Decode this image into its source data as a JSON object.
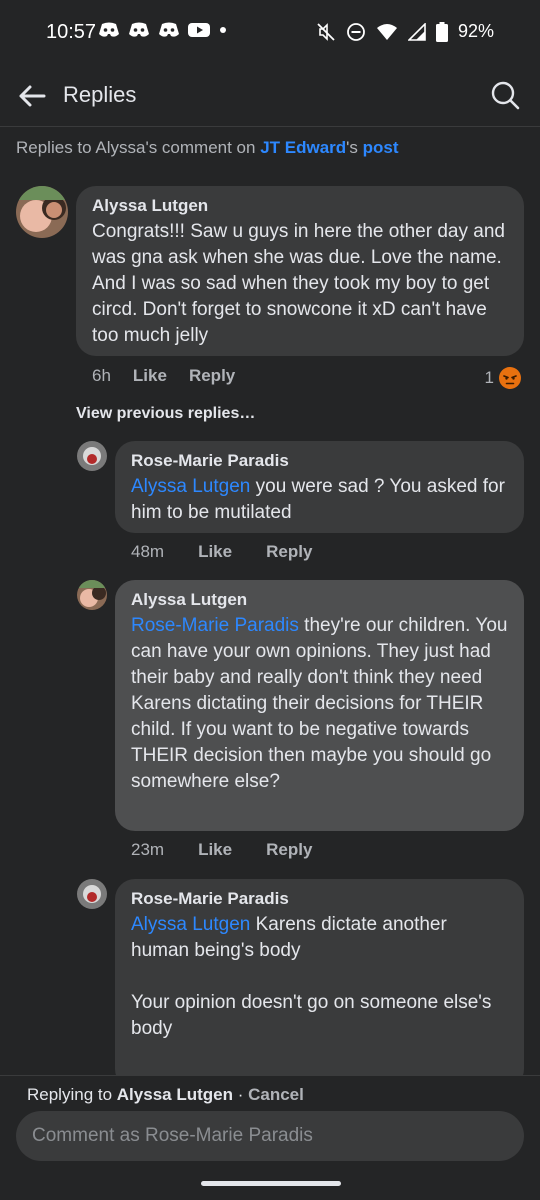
{
  "status_bar": {
    "time": "10:57",
    "battery": "92%",
    "icons": [
      "discord-icon",
      "discord-icon",
      "discord-icon",
      "youtube-icon",
      "dot-icon",
      "mute-icon",
      "dnd-icon",
      "wifi-icon",
      "signal-icon",
      "battery-icon"
    ]
  },
  "header": {
    "title": "Replies",
    "back_icon": "back-arrow-icon",
    "search_icon": "search-icon"
  },
  "context": {
    "prefix": "Replies to Alyssa's comment on ",
    "user": "JT Edward",
    "possessive": "'s ",
    "post": "post"
  },
  "comments": [
    {
      "author": "Alyssa Lutgen",
      "text": "Congrats!!! Saw u guys in here the other day and was gna ask when she was due. Love the name. And I was so sad when they took my boy to get circd. Don't forget to snowcone it xD can't have too much jelly",
      "time": "6h",
      "like": "Like",
      "reply": "Reply",
      "reaction_count": "1",
      "reaction_icon": "angry-reaction-icon"
    },
    {
      "author": "Rose-Marie Paradis",
      "mention": "Alyssa Lutgen",
      "text": " you were sad ? You asked for him to be mutilated",
      "time": "48m",
      "like": "Like",
      "reply": "Reply"
    },
    {
      "author": "Alyssa Lutgen",
      "mention": "Rose-Marie Paradis",
      "text": " they're our children. You can have your own opinions. They just had their baby and really don't think they need Karens dictating their decisions for THEIR child. If you want to be negative towards THEIR decision then maybe you should go somewhere else?",
      "time": "23m",
      "like": "Like",
      "reply": "Reply"
    },
    {
      "author": "Rose-Marie Paradis",
      "mention": "Alyssa Lutgen",
      "text": " Karens dictate another human being's body\n\nYour opinion doesn't go on someone else's body"
    }
  ],
  "view_previous": "View previous replies…",
  "footer": {
    "replying_prefix": "Replying to ",
    "replying_to": "Alyssa Lutgen",
    "separator": " · ",
    "cancel": "Cancel",
    "placeholder": "Comment as Rose-Marie Paradis"
  },
  "colors": {
    "background": "#242526",
    "bubble": "#3a3b3c",
    "bubble_highlight": "#4e4f50",
    "link": "#2d88ff",
    "angry": "#e9710f"
  }
}
